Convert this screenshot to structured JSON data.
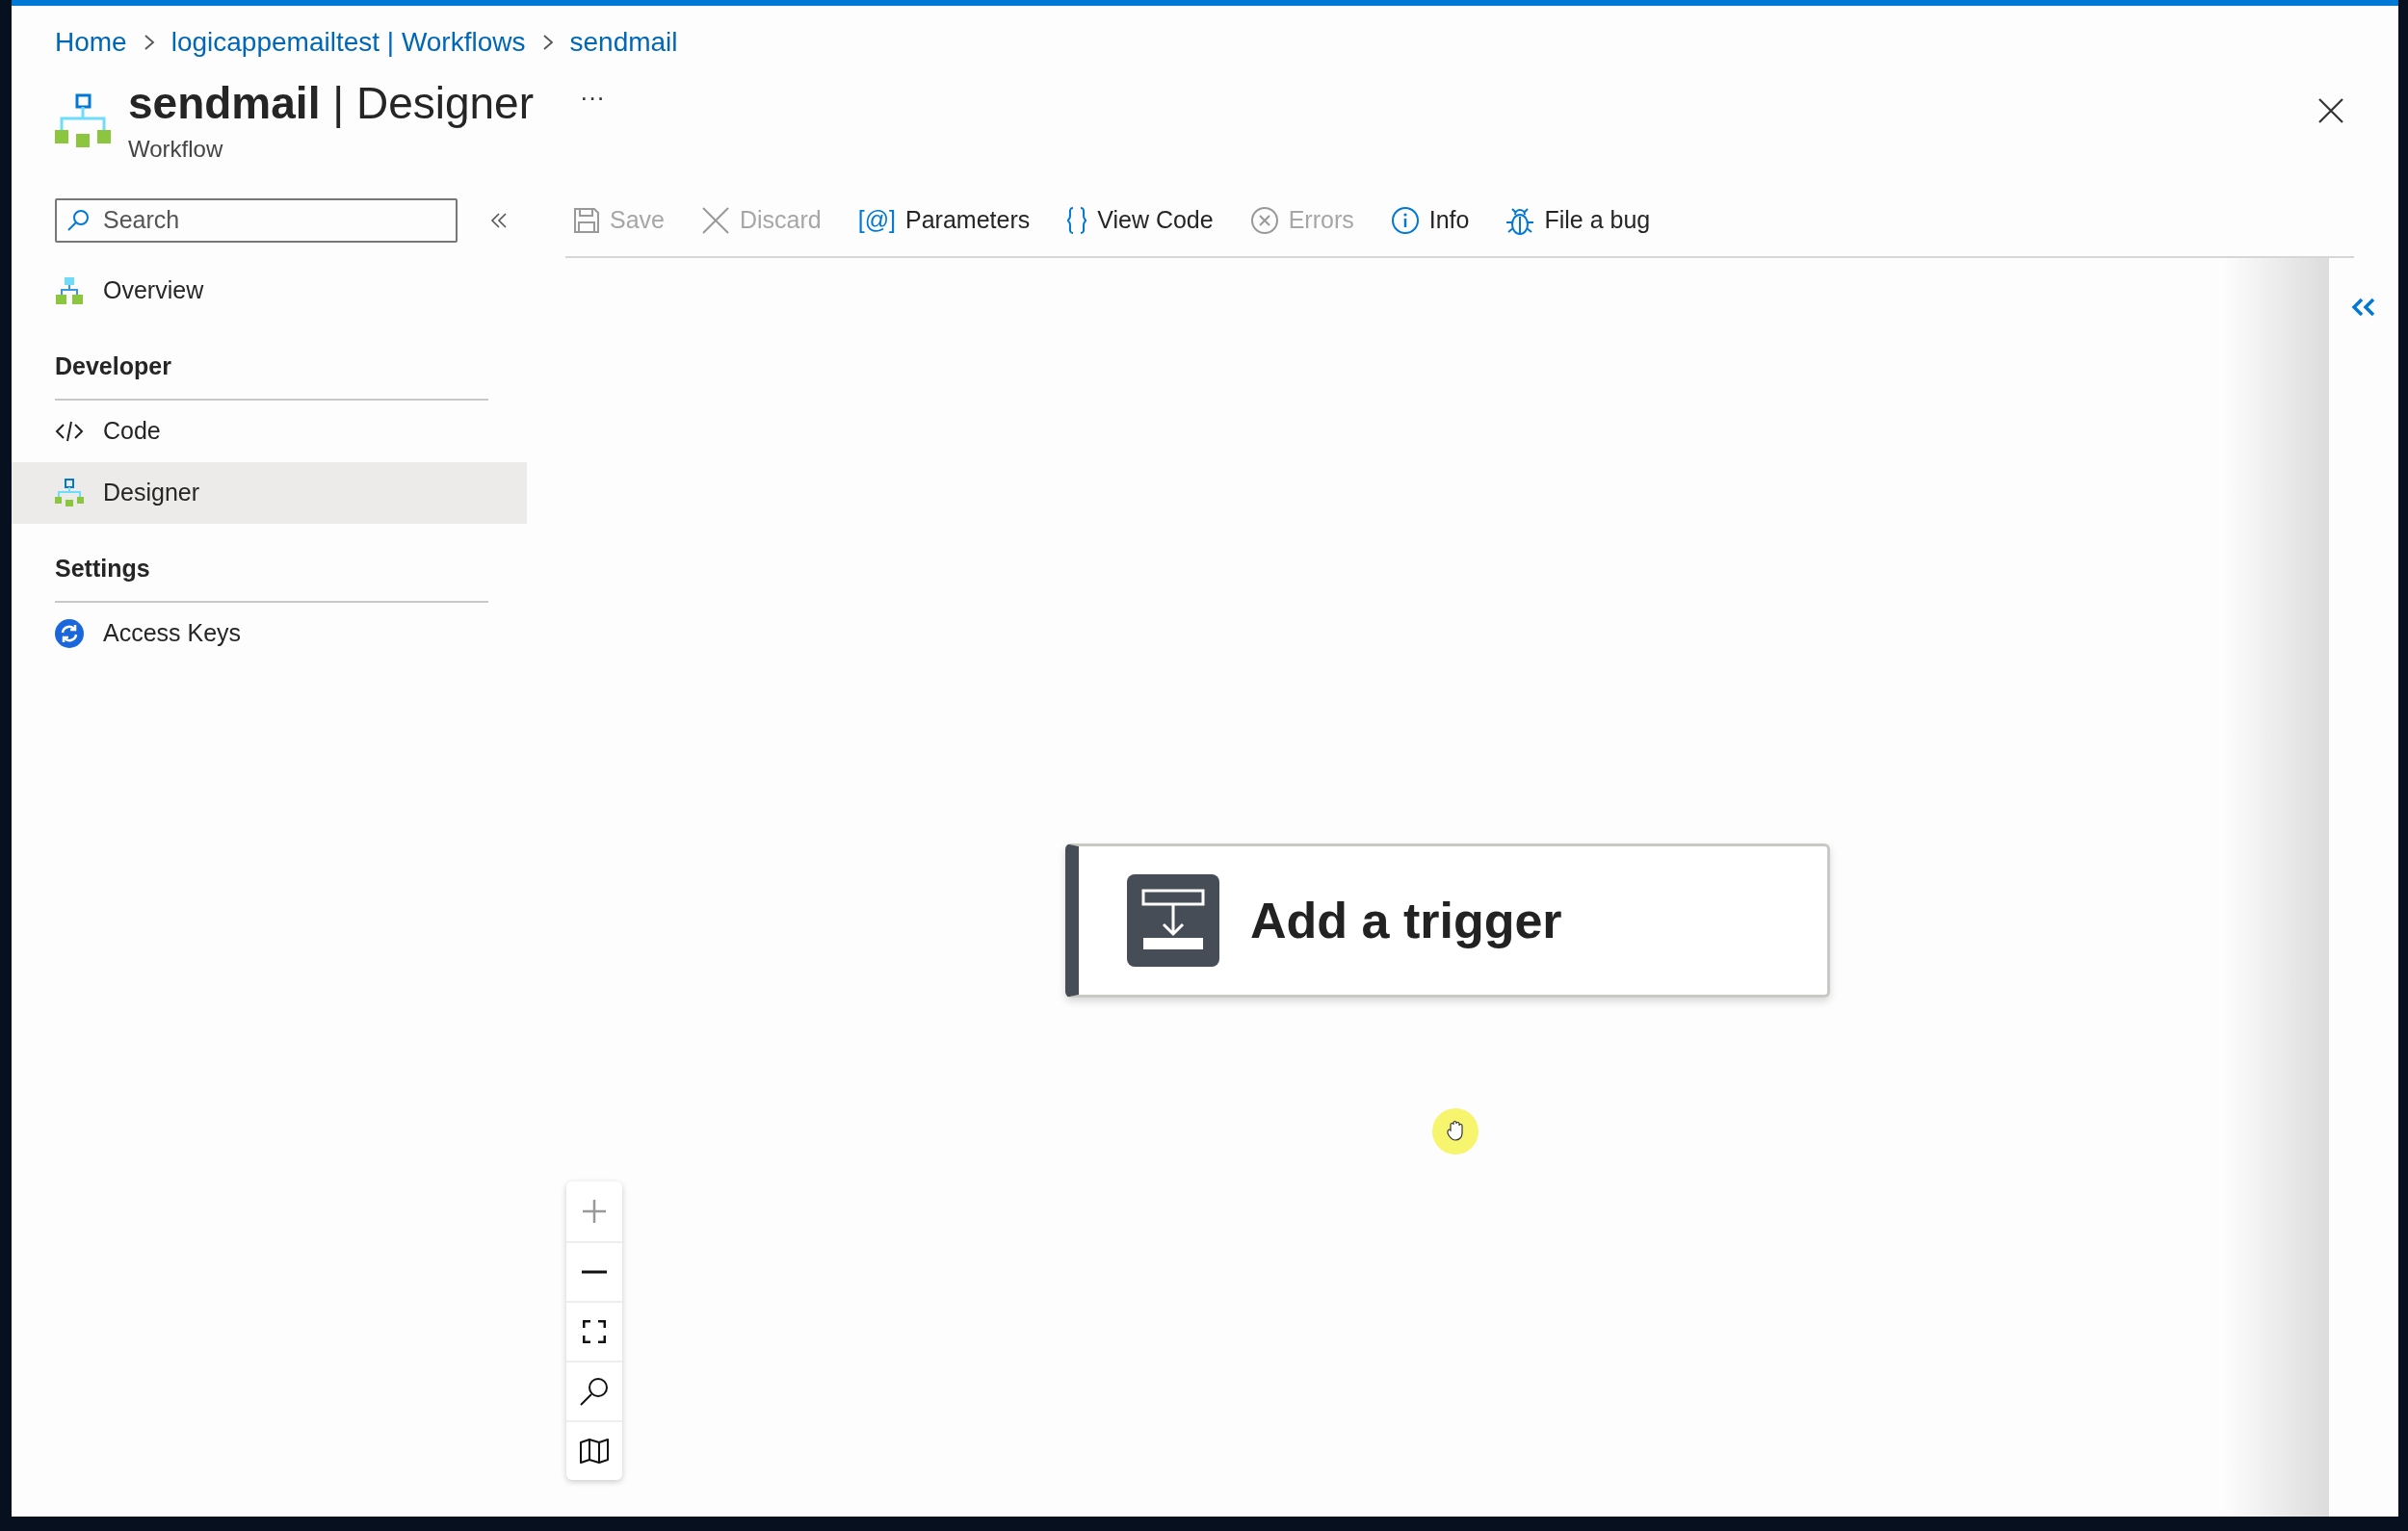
{
  "breadcrumb": [
    {
      "label": "Home"
    },
    {
      "label": "logicappemailtest | Workflows"
    },
    {
      "label": "sendmail"
    }
  ],
  "header": {
    "title": "**sendmail** | Designer",
    "subtitle": "Workflow",
    "more": "···"
  },
  "search": {
    "placeholder": "Search"
  },
  "sidebar": [
    {
      "kind": "item",
      "label": "Overview",
      "selected": false
    },
    {
      "kind": "header",
      "label": "Developer"
    },
    {
      "kind": "item",
      "label": "Code",
      "selected": false
    },
    {
      "kind": "item",
      "label": "Designer",
      "selected": true
    },
    {
      "kind": "header",
      "label": "Settings"
    },
    {
      "kind": "item",
      "label": "Access Keys",
      "selected": false
    }
  ],
  "toolbar": [
    {
      "label": "Save",
      "disabled": true
    },
    {
      "label": "Discard",
      "disabled": true
    },
    {
      "label": "Parameters",
      "glyph": "[@]",
      "disabled": false
    },
    {
      "label": "View Code",
      "disabled": false
    },
    {
      "label": "Errors",
      "disabled": true
    },
    {
      "label": "Info",
      "disabled": false
    },
    {
      "label": "File a bug",
      "disabled": false
    }
  ],
  "canvas": {
    "trigger": {
      "label": "Add a trigger"
    },
    "zoom_controls": [
      {
        "disabled": true
      },
      {
        "disabled": false
      },
      {
        "disabled": false
      },
      {
        "disabled": false
      },
      {
        "disabled": false
      }
    ]
  }
}
